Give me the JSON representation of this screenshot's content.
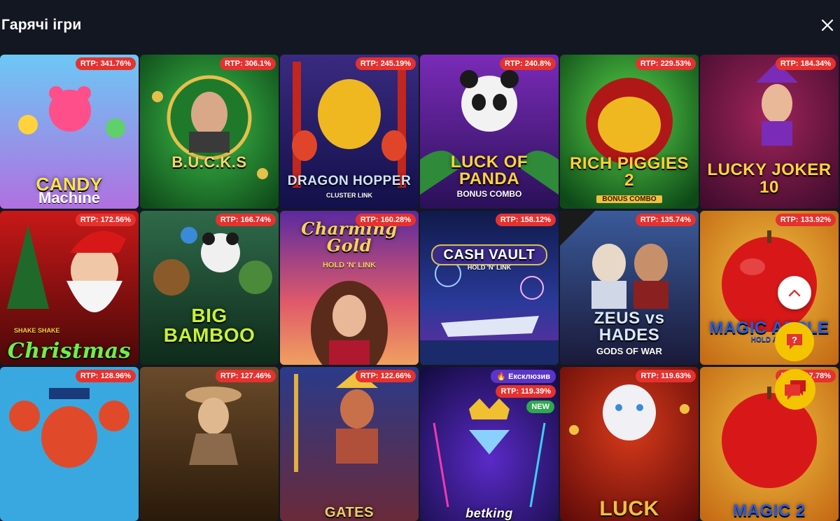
{
  "header": {
    "title": "Гарячі ігри"
  },
  "icons": {
    "close": "close-icon",
    "scroll_up": "chevron-up-icon",
    "help": "help-chat-icon",
    "chat": "chat-bubble-icon",
    "flame": "flame-icon"
  },
  "colors": {
    "background": "#131722",
    "rtp_badge": "#e5322f",
    "exclusive_badge": "#5a35c8",
    "new_badge": "#2fa84f",
    "fab_yellow": "#f5c400"
  },
  "games": [
    {
      "rtp": "RTP: 341.76%",
      "title": "CANDY",
      "subtitle": "Machine"
    },
    {
      "rtp": "RTP: 306.1%",
      "title": "B.U.C.K.S",
      "subtitle": ""
    },
    {
      "rtp": "RTP: 245.19%",
      "title": "DRAGON HOPPER",
      "subtitle": "CLUSTER LINK"
    },
    {
      "rtp": "RTP: 240.8%",
      "title": "LUCK OF PANDA",
      "subtitle": "BONUS COMBO"
    },
    {
      "rtp": "RTP: 229.53%",
      "title": "RICH PIGGIES 2",
      "subtitle": "BONUS COMBO"
    },
    {
      "rtp": "RTP: 184.34%",
      "title": "LUCKY JOKER 10",
      "subtitle": ""
    },
    {
      "rtp": "RTP: 172.56%",
      "title": "Christmas",
      "subtitle": "SHAKE SHAKE"
    },
    {
      "rtp": "RTP: 166.74%",
      "title": "BIG BAMBOO",
      "subtitle": ""
    },
    {
      "rtp": "RTP: 160.28%",
      "title": "Charming Gold",
      "subtitle": "HOLD 'N' LINK"
    },
    {
      "rtp": "RTP: 158.12%",
      "title": "CASH VAULT",
      "subtitle": "HOLD 'N' LINK"
    },
    {
      "rtp": "RTP: 135.74%",
      "title": "ZEUS vs HADES",
      "subtitle": "GODS OF WAR"
    },
    {
      "rtp": "RTP: 133.92%",
      "title": "MAGIC APPLE",
      "subtitle": "HOLD AND"
    },
    {
      "rtp": "RTP: 128.96%",
      "title": "",
      "subtitle": ""
    },
    {
      "rtp": "RTP: 127.46%",
      "title": "",
      "subtitle": ""
    },
    {
      "rtp": "RTP: 122.66%",
      "title": "GATES",
      "subtitle": ""
    },
    {
      "rtp": "RTP: 119.39%",
      "title": "betking",
      "subtitle": "",
      "exclusive": "Ексклюзив",
      "new": "NEW"
    },
    {
      "rtp": "RTP: 119.63%",
      "title": "LUCK",
      "subtitle": ""
    },
    {
      "rtp": "RTP: 117.78%",
      "title": "MAGIC 2",
      "subtitle": ""
    }
  ]
}
